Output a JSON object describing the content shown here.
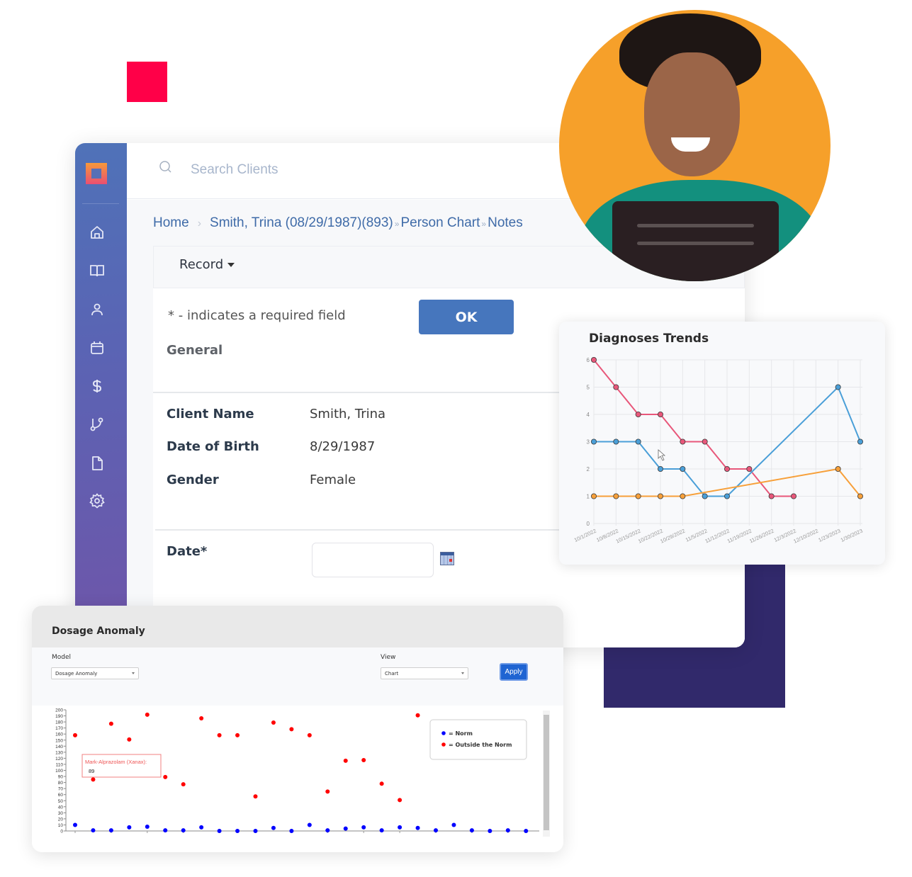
{
  "colors": {
    "accent_red": "#ff0048",
    "navy": "#31296b",
    "photo_bg": "#f6a02a",
    "ok_button": "#4676bd",
    "link": "#3f6ba8",
    "apply_button": "#1f64d2",
    "norm": "#0000ff",
    "outside_norm": "#ff0000"
  },
  "sidebar": {
    "items": [
      {
        "icon": "home-icon"
      },
      {
        "icon": "book-icon"
      },
      {
        "icon": "user-icon"
      },
      {
        "icon": "calendar-icon"
      },
      {
        "icon": "dollar-icon"
      },
      {
        "icon": "git-branch-icon"
      },
      {
        "icon": "file-icon"
      },
      {
        "icon": "settings-icon"
      }
    ]
  },
  "search": {
    "placeholder": "Search Clients"
  },
  "breadcrumb": {
    "home": "Home",
    "client": "Smith, Trina (08/29/1987)(893)",
    "person_chart": "Person Chart",
    "notes": "Notes",
    "sep": "»"
  },
  "toolbar": {
    "record_label": "Record"
  },
  "form": {
    "required_note": "* - indicates a required field",
    "ok_label": "OK",
    "section_title": "General",
    "fields": [
      {
        "label": "Client Name",
        "value": "Smith, Trina"
      },
      {
        "label": "Date of Birth",
        "value": "8/29/1987"
      },
      {
        "label": "Gender",
        "value": "Female"
      }
    ],
    "date_label": "Date*",
    "date_value": ""
  },
  "trends": {
    "title": "Diagnoses Trends"
  },
  "dosage": {
    "title": "Dosage Anomaly",
    "model_label": "Model",
    "model_value": "Dosage Anomaly",
    "view_label": "View",
    "view_value": "Chart",
    "apply_label": "Apply",
    "tooltip_title": "Mark-Alprazolam (Xanax):",
    "tooltip_value": "89",
    "legend_norm": "= Norm",
    "legend_outside": "= Outside the Norm"
  },
  "chart_data": [
    {
      "type": "line",
      "title": "Diagnoses Trends",
      "x": [
        "10/1/2022",
        "10/8/2022",
        "10/15/2022",
        "10/22/2022",
        "10/29/2022",
        "11/5/2022",
        "11/12/2022",
        "11/19/2022",
        "11/26/2022",
        "12/3/2022",
        "12/10/2022",
        "1/23/2023",
        "1/30/2023"
      ],
      "ylim": [
        0,
        6
      ],
      "yticks": [
        0,
        1,
        2,
        3,
        4,
        5,
        6
      ],
      "grid": true,
      "series": [
        {
          "name": "pink",
          "color": "#e8577a",
          "points": [
            [
              0,
              6
            ],
            [
              1,
              5
            ],
            [
              2,
              4
            ],
            [
              3,
              4
            ],
            [
              4,
              3
            ],
            [
              5,
              3
            ],
            [
              6,
              2
            ],
            [
              7,
              2
            ],
            [
              8,
              1
            ],
            [
              9,
              1
            ]
          ]
        },
        {
          "name": "blue",
          "color": "#4a9fd8",
          "points": [
            [
              0,
              3
            ],
            [
              1,
              3
            ],
            [
              2,
              3
            ],
            [
              3,
              2
            ],
            [
              4,
              2
            ],
            [
              5,
              1
            ],
            [
              6,
              1
            ],
            [
              11,
              5
            ],
            [
              12,
              3
            ]
          ]
        },
        {
          "name": "orange",
          "color": "#f7a03a",
          "points": [
            [
              0,
              1
            ],
            [
              1,
              1
            ],
            [
              2,
              1
            ],
            [
              3,
              1
            ],
            [
              4,
              1
            ],
            [
              11,
              2
            ],
            [
              12,
              1
            ]
          ]
        }
      ]
    },
    {
      "type": "scatter",
      "title": "Dosage Anomaly",
      "ylim": [
        0,
        200
      ],
      "yticks": [
        0,
        10,
        20,
        30,
        40,
        50,
        60,
        70,
        80,
        90,
        100,
        110,
        120,
        130,
        140,
        150,
        160,
        170,
        180,
        190,
        200
      ],
      "legend": "top-right",
      "series": [
        {
          "name": "Outside the Norm",
          "color": "#ff0000",
          "x": [
            0,
            1,
            2,
            3,
            4,
            5,
            6,
            7,
            8,
            9,
            10,
            11,
            12,
            13,
            14,
            15,
            16,
            17,
            18,
            19
          ],
          "values": [
            158,
            85,
            177,
            151,
            192,
            89,
            77,
            186,
            158,
            158,
            57,
            179,
            168,
            158,
            65,
            116,
            117,
            78,
            51,
            191
          ]
        },
        {
          "name": "Norm",
          "color": "#0000ff",
          "x": [
            0,
            1,
            2,
            3,
            4,
            5,
            6,
            7,
            8,
            9,
            10,
            11,
            12,
            13,
            14,
            15,
            16,
            17,
            18,
            19,
            20,
            21,
            22,
            23,
            24,
            25
          ],
          "values": [
            10,
            1,
            1,
            6,
            7,
            1,
            1,
            6,
            0,
            0,
            0,
            5,
            0,
            10,
            1,
            4,
            6,
            1,
            6,
            5,
            1,
            10,
            1,
            0,
            1,
            0
          ]
        }
      ]
    }
  ]
}
